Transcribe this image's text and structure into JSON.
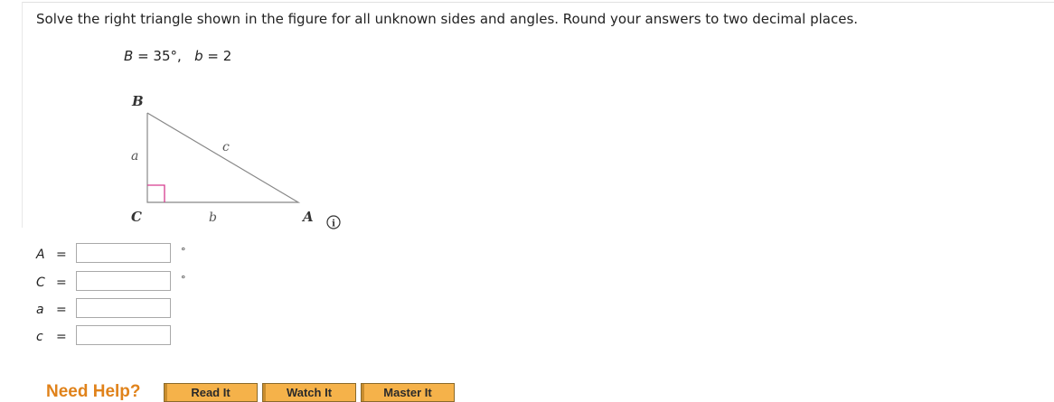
{
  "question": {
    "text": "Solve the right triangle shown in the figure for all unknown sides and angles. Round your answers to two decimal places."
  },
  "given": {
    "B_var": "B",
    "B_eq": " = 35°,   ",
    "b_var": "b",
    "b_eq": " = 2"
  },
  "figure": {
    "vertex_B": "B",
    "vertex_C": "C",
    "vertex_A": "A",
    "side_a": "a",
    "side_b": "b",
    "side_c": "c",
    "triangle_color": "#888888",
    "right_angle_color": "#d63c8f",
    "info_glyph": "i",
    "info_icon": "info-circle-icon"
  },
  "answers": [
    {
      "var": "A",
      "eq": "=",
      "value": "",
      "unit": "°"
    },
    {
      "var": "C",
      "eq": "=",
      "value": "",
      "unit": "°"
    },
    {
      "var": "a",
      "eq": "=",
      "value": "",
      "unit": ""
    },
    {
      "var": "c",
      "eq": "=",
      "value": "",
      "unit": ""
    }
  ],
  "help": {
    "title": "Need Help?",
    "buttons": [
      "Read It",
      "Watch It",
      "Master It"
    ]
  }
}
